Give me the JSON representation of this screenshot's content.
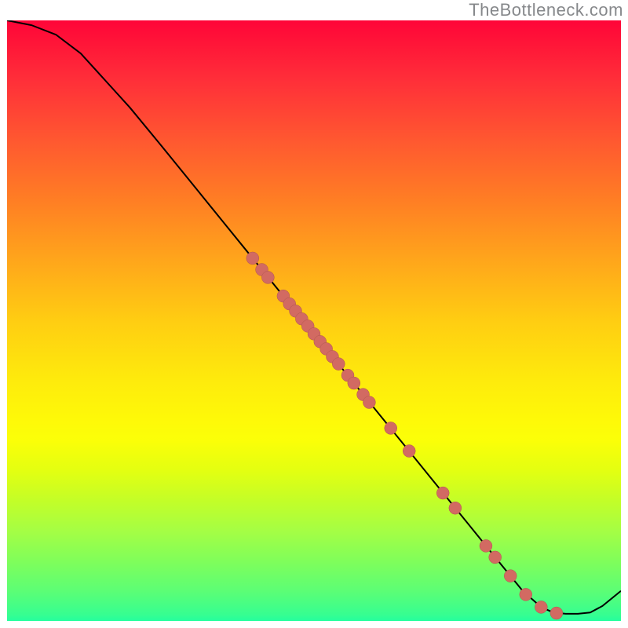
{
  "watermark": "TheBottleneck.com",
  "colors": {
    "curve": "#000000",
    "marker_fill": "#d26a62",
    "marker_stroke": "#b0574f"
  },
  "chart_data": {
    "type": "line",
    "title": "",
    "xlabel": "",
    "ylabel": "",
    "xlim": [
      0,
      100
    ],
    "ylim": [
      0,
      100
    ],
    "curve": [
      {
        "x": 0,
        "y": 100.0
      },
      {
        "x": 4,
        "y": 99.2
      },
      {
        "x": 8,
        "y": 97.6
      },
      {
        "x": 12,
        "y": 94.5
      },
      {
        "x": 16,
        "y": 90.0
      },
      {
        "x": 20,
        "y": 85.5
      },
      {
        "x": 25,
        "y": 79.3
      },
      {
        "x": 30,
        "y": 73.0
      },
      {
        "x": 35,
        "y": 66.7
      },
      {
        "x": 40,
        "y": 60.4
      },
      {
        "x": 45,
        "y": 54.1
      },
      {
        "x": 50,
        "y": 47.8
      },
      {
        "x": 55,
        "y": 41.5
      },
      {
        "x": 60,
        "y": 35.2
      },
      {
        "x": 65,
        "y": 28.9
      },
      {
        "x": 70,
        "y": 22.6
      },
      {
        "x": 75,
        "y": 16.3
      },
      {
        "x": 80,
        "y": 10.0
      },
      {
        "x": 84,
        "y": 5.0
      },
      {
        "x": 87,
        "y": 2.3
      },
      {
        "x": 89,
        "y": 1.4
      },
      {
        "x": 91,
        "y": 1.2
      },
      {
        "x": 93,
        "y": 1.2
      },
      {
        "x": 95,
        "y": 1.4
      },
      {
        "x": 97,
        "y": 2.5
      },
      {
        "x": 100,
        "y": 5.0
      }
    ],
    "markers": [
      {
        "x": 40.0,
        "y": 60.4
      },
      {
        "x": 41.5,
        "y": 58.5
      },
      {
        "x": 42.5,
        "y": 57.2
      },
      {
        "x": 45.0,
        "y": 54.1
      },
      {
        "x": 46.0,
        "y": 52.8
      },
      {
        "x": 47.0,
        "y": 51.6
      },
      {
        "x": 48.0,
        "y": 50.3
      },
      {
        "x": 49.0,
        "y": 49.1
      },
      {
        "x": 50.0,
        "y": 47.8
      },
      {
        "x": 51.0,
        "y": 46.5
      },
      {
        "x": 52.0,
        "y": 45.3
      },
      {
        "x": 53.0,
        "y": 44.0
      },
      {
        "x": 54.0,
        "y": 42.8
      },
      {
        "x": 55.5,
        "y": 40.9
      },
      {
        "x": 56.5,
        "y": 39.6
      },
      {
        "x": 58.0,
        "y": 37.7
      },
      {
        "x": 59.0,
        "y": 36.4
      },
      {
        "x": 62.5,
        "y": 32.1
      },
      {
        "x": 65.5,
        "y": 28.3
      },
      {
        "x": 71.0,
        "y": 21.3
      },
      {
        "x": 73.0,
        "y": 18.8
      },
      {
        "x": 78.0,
        "y": 12.5
      },
      {
        "x": 79.5,
        "y": 10.6
      },
      {
        "x": 82.0,
        "y": 7.5
      },
      {
        "x": 84.5,
        "y": 4.4
      },
      {
        "x": 87.0,
        "y": 2.3
      },
      {
        "x": 89.5,
        "y": 1.3
      }
    ]
  }
}
